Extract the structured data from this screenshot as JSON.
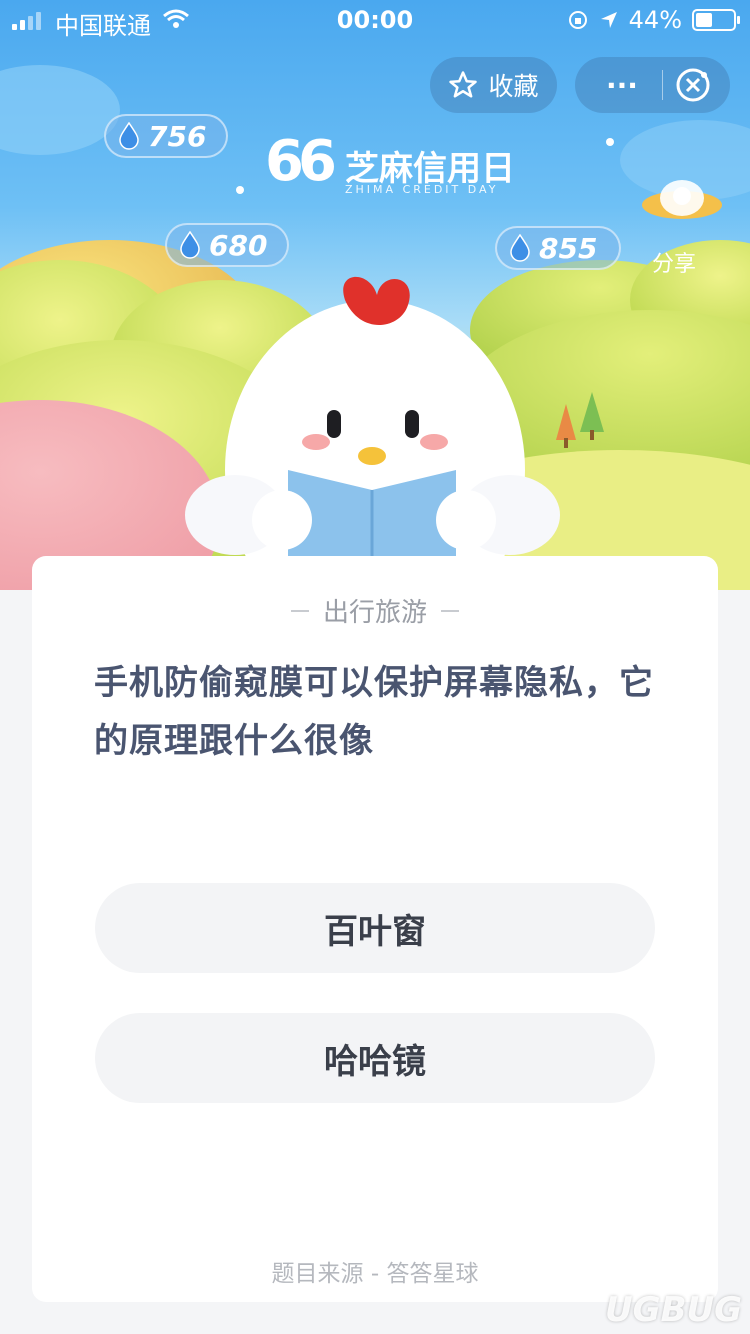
{
  "status_bar": {
    "carrier": "中国联通",
    "time": "00:00",
    "battery": "44%"
  },
  "header": {
    "favorite_label": "收藏",
    "more_label": "···",
    "share_label": "分享"
  },
  "logo": {
    "number": "66",
    "name": "芝麻信用日",
    "subtitle": "ZHIMA CREDIT DAY"
  },
  "scores": [
    "756",
    "680",
    "855"
  ],
  "quiz": {
    "category": "出行旅游",
    "question": "手机防偷窥膜可以保护屏幕隐私，它的原理跟什么很像",
    "options": [
      "百叶窗",
      "哈哈镜"
    ],
    "source": "题目来源 - 答答星球"
  },
  "watermark": "UGBUG",
  "colors": {
    "sky": "#4aa8ef",
    "question_text": "#4a5570",
    "option_bg": "#f3f4f6",
    "chick_comb": "#e0312b",
    "book": "#8cc2ec"
  }
}
